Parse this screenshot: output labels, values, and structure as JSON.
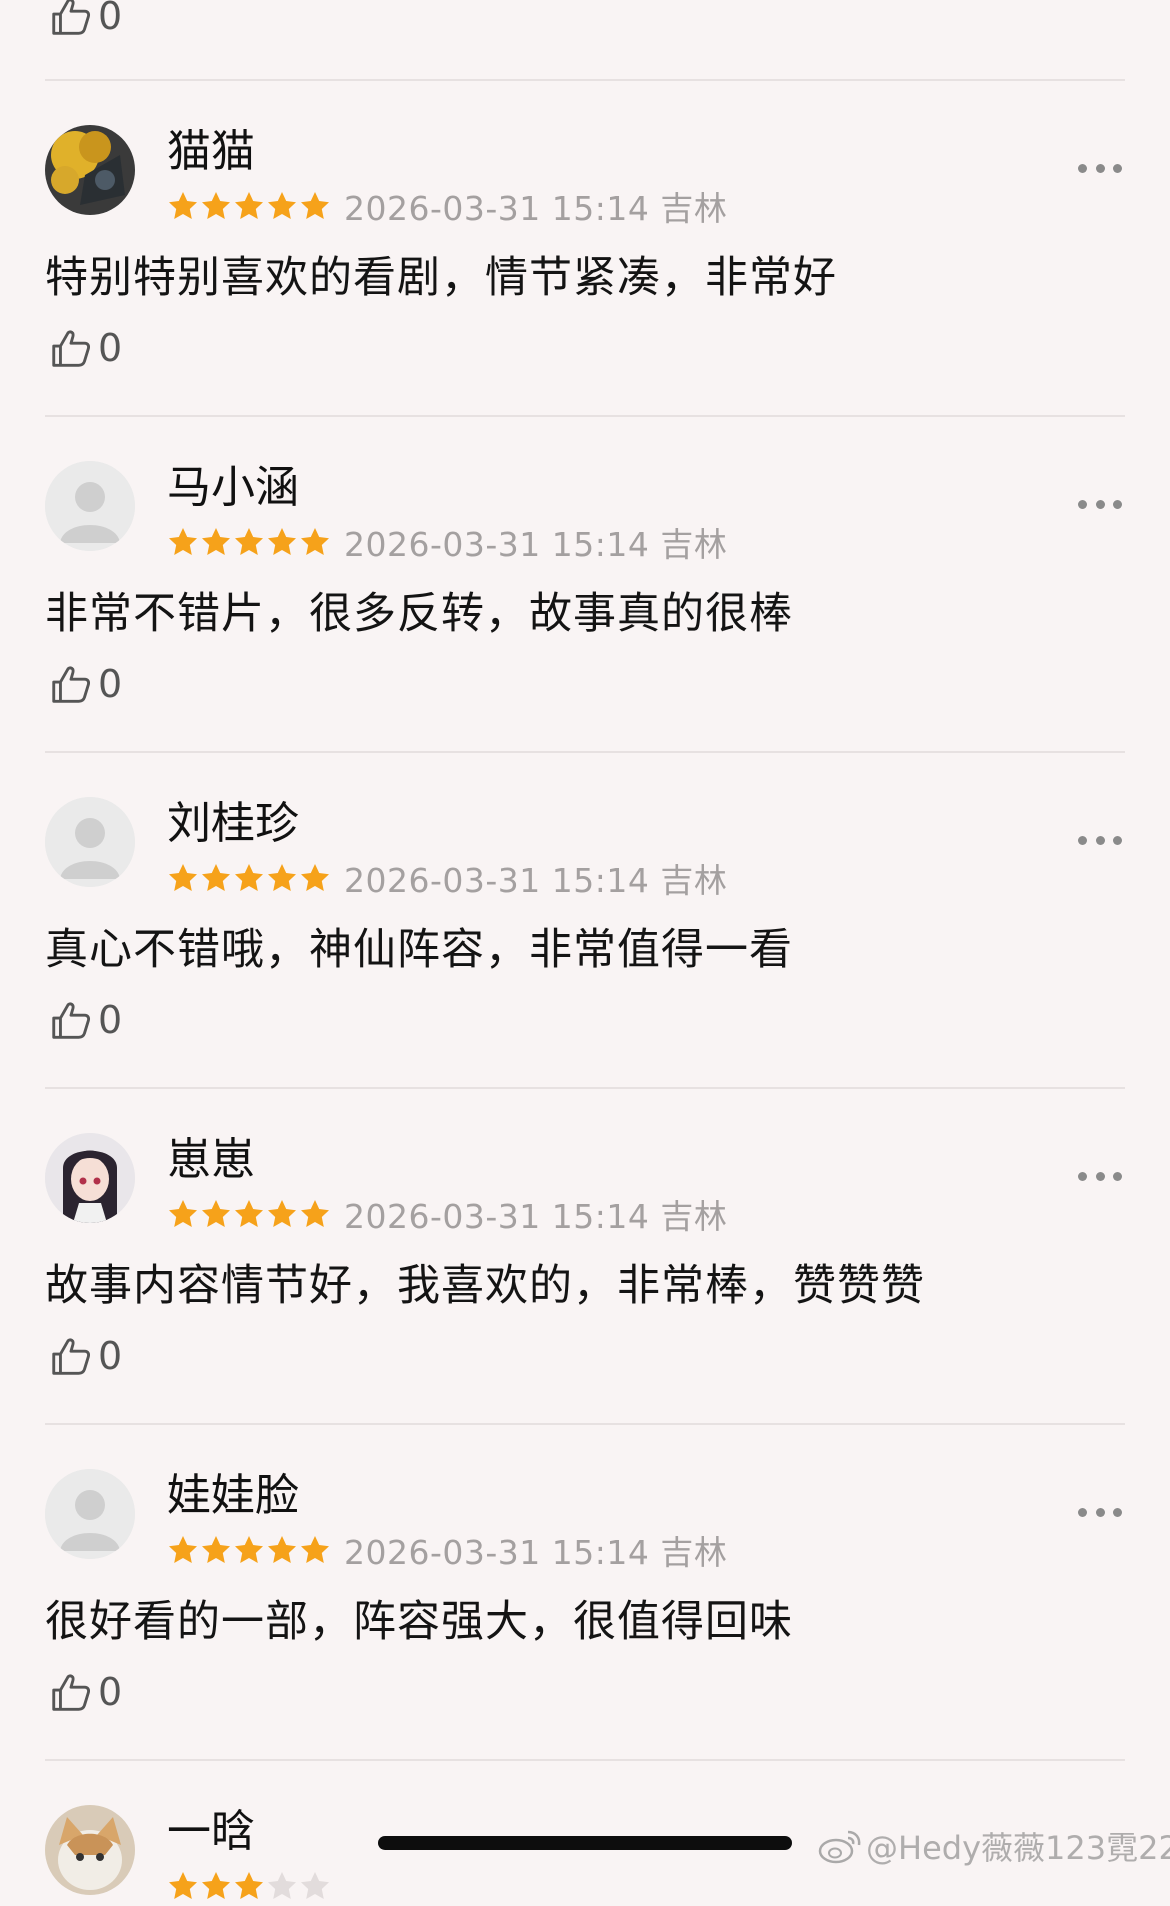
{
  "colors": {
    "star": "#f6a21a",
    "meta": "#a4a0a0",
    "background": "#f9f4f4"
  },
  "top_partial": {
    "like_count": "0"
  },
  "comments": [
    {
      "username": "猫猫",
      "meta": "2026-03-31 15:14 吉林",
      "rating": 5,
      "text": "特别特别喜欢的看剧，情节紧凑，非常好",
      "like_count": "0",
      "avatar": "photo"
    },
    {
      "username": "马小涵",
      "meta": "2026-03-31 15:14 吉林",
      "rating": 5,
      "text": "非常不错片，很多反转，故事真的很棒",
      "like_count": "0",
      "avatar": "default"
    },
    {
      "username": "刘桂珍",
      "meta": "2026-03-31 15:14 吉林",
      "rating": 5,
      "text": "真心不错哦，神仙阵容，非常值得一看",
      "like_count": "0",
      "avatar": "default"
    },
    {
      "username": "崽崽",
      "meta": "2026-03-31 15:14 吉林",
      "rating": 5,
      "text": "故事内容情节好，我喜欢的，非常棒，赞赞赞",
      "like_count": "0",
      "avatar": "anime"
    },
    {
      "username": "娃娃脸",
      "meta": "2026-03-31 15:14 吉林",
      "rating": 5,
      "text": "很好看的一部，阵容强大，很值得回味",
      "like_count": "0",
      "avatar": "default"
    },
    {
      "username": "一晗",
      "meta": "",
      "rating": 3,
      "text": "",
      "like_count": "",
      "avatar": "cat"
    }
  ],
  "watermark": "@Hedy薇薇123霓22"
}
